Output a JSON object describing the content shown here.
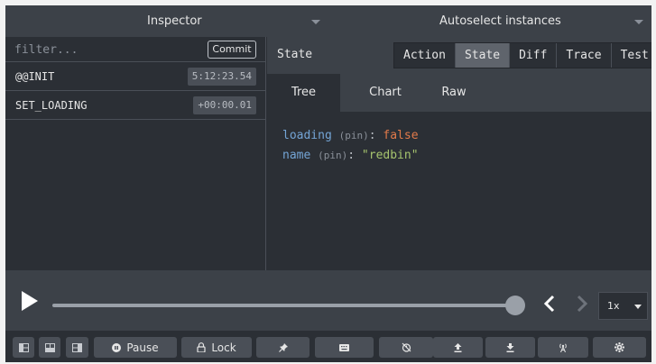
{
  "topbar": {
    "inspector_label": "Inspector",
    "instances_label": "Autoselect instances"
  },
  "left": {
    "filter_placeholder": "filter...",
    "commit_label": "Commit",
    "actions": [
      {
        "name": "@@INIT",
        "time": "5:12:23.54"
      },
      {
        "name": "SET_LOADING",
        "time": "+00:00.01"
      }
    ]
  },
  "right": {
    "title": "State",
    "tabs": [
      "Action",
      "State",
      "Diff",
      "Trace",
      "Test"
    ],
    "active_tab": "State",
    "subtabs": [
      "Tree",
      "Chart",
      "Raw"
    ],
    "active_subtab": "Tree",
    "tree": [
      {
        "key": "loading",
        "pin": "(pin)",
        "colon": ":",
        "value": "false"
      },
      {
        "key": "name",
        "pin": "(pin)",
        "colon": ":",
        "value": "\"redbin\""
      }
    ]
  },
  "slider": {
    "speed": "1x",
    "position": 1.0
  },
  "toolbar": {
    "pause_label": "Pause",
    "lock_label": "Lock",
    "icons": [
      "layout-left-icon",
      "layout-bottom-icon",
      "layout-right-icon",
      "pin-icon",
      "keyboard-icon",
      "persist-icon",
      "upload-icon",
      "download-icon",
      "remote-icon",
      "settings-icon"
    ]
  },
  "colors": {
    "background": "#2b2f35",
    "header": "#3c4148",
    "key": "#74a5d6",
    "boolean": "#e27a4a",
    "string": "#a6c46e"
  }
}
